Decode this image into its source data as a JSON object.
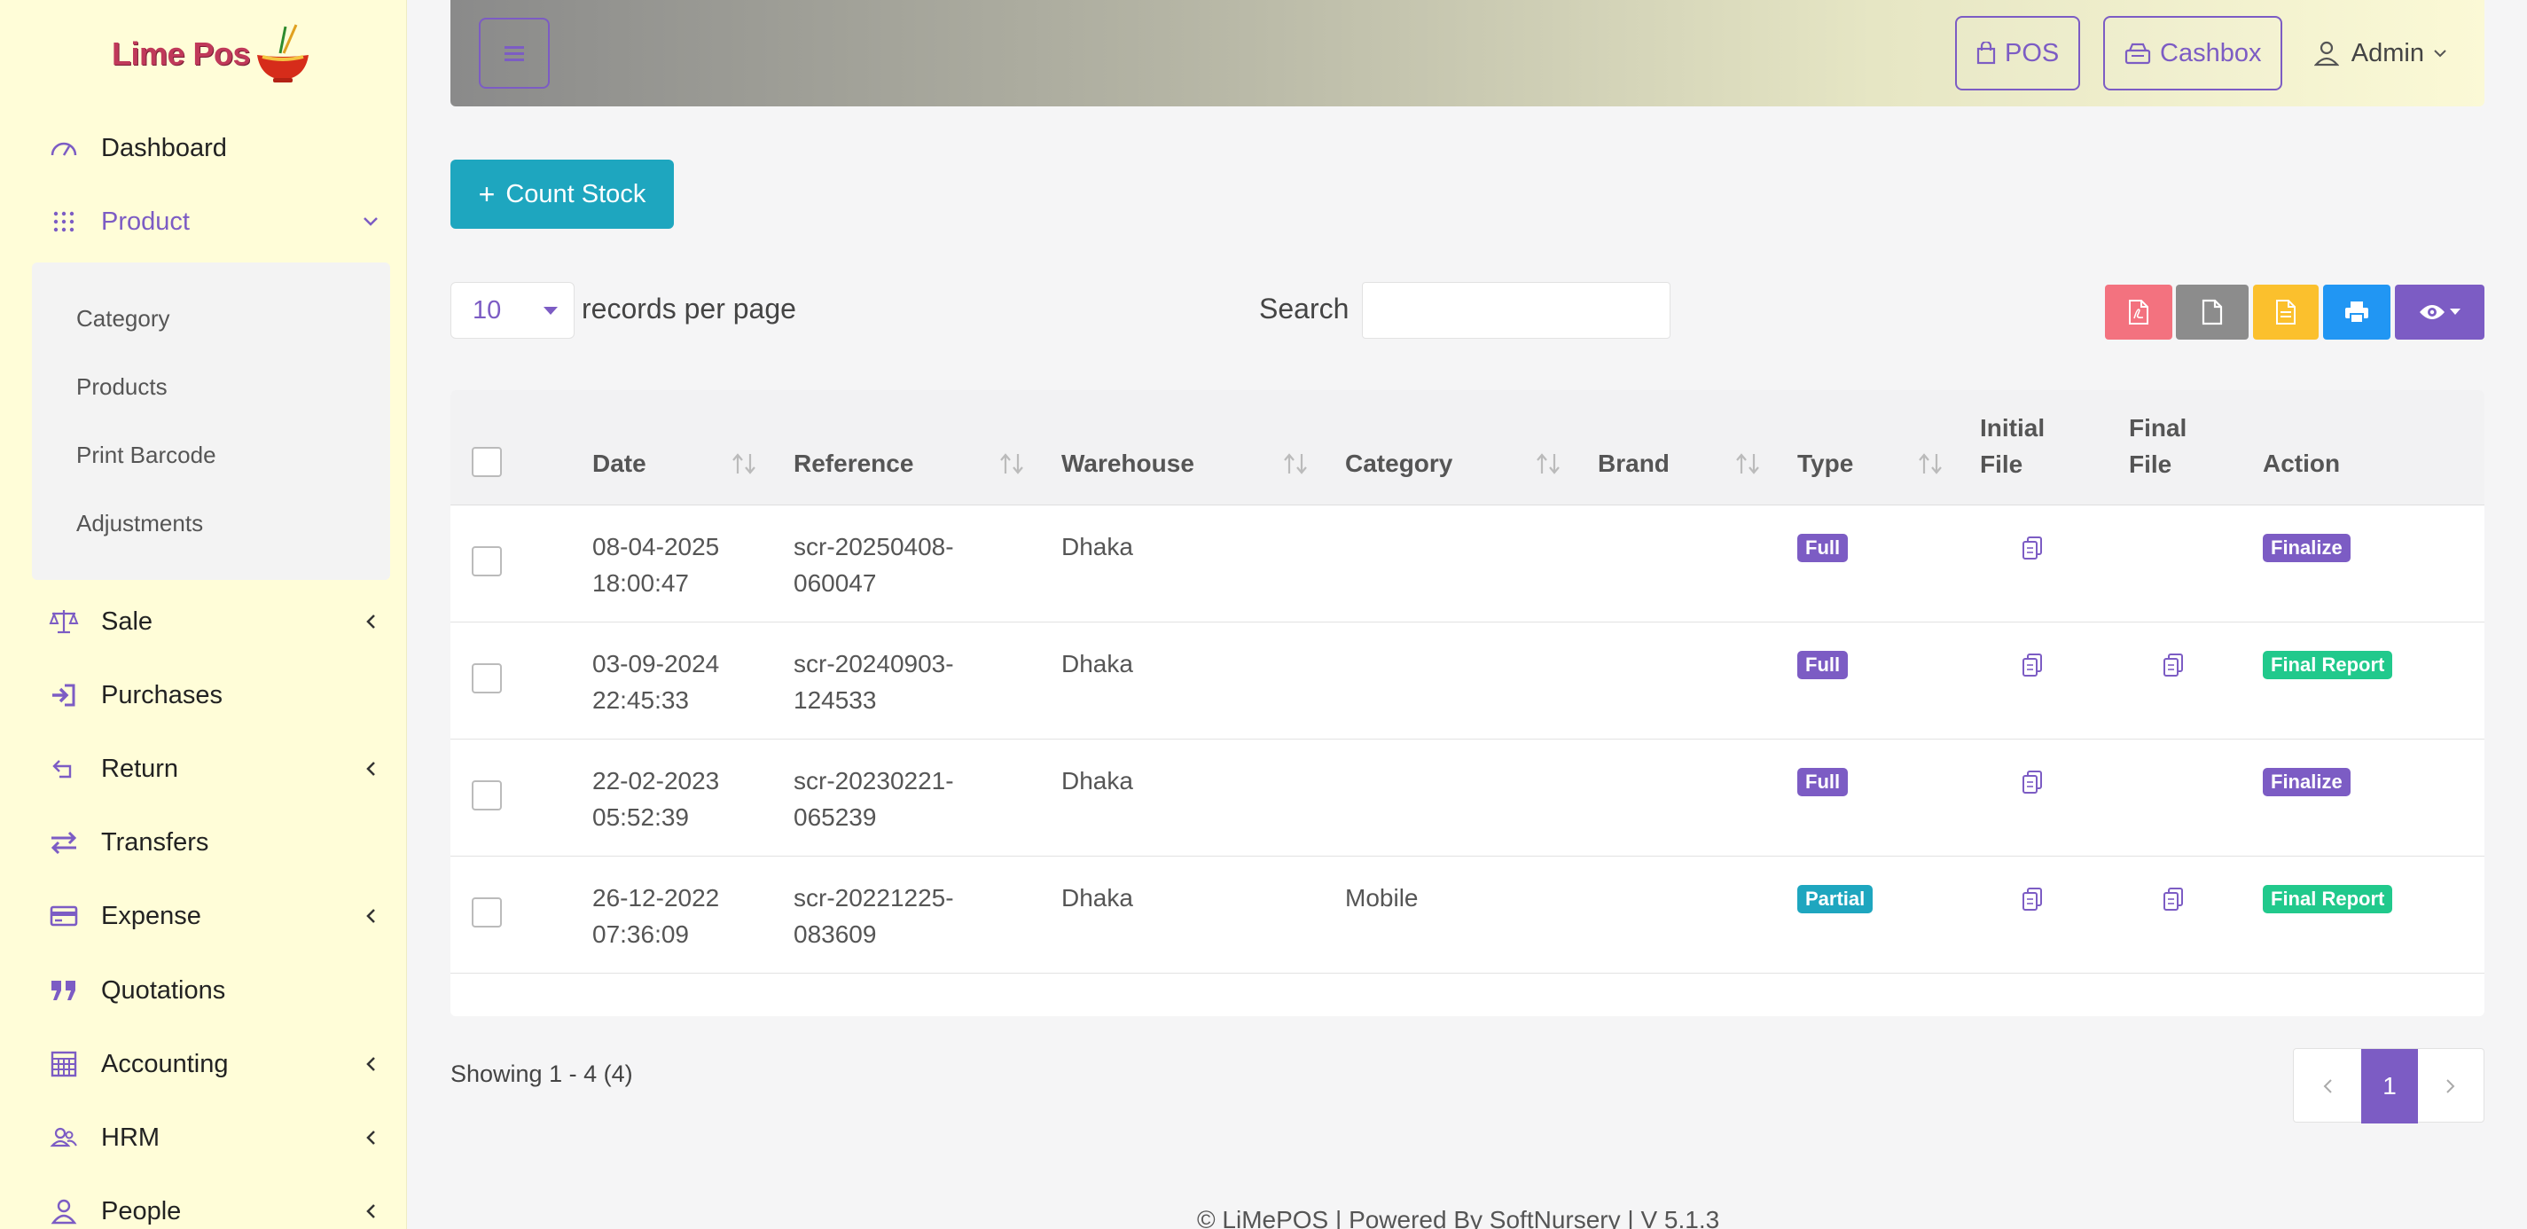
{
  "brand": {
    "name": "Lime Pos"
  },
  "sidebar": {
    "items": [
      {
        "label": "Dashboard",
        "icon": "gauge-icon"
      },
      {
        "label": "Product",
        "icon": "grid-dots-icon"
      },
      {
        "label": "Sale",
        "icon": "scale-icon"
      },
      {
        "label": "Purchases",
        "icon": "sign-in-icon"
      },
      {
        "label": "Return",
        "icon": "return-icon"
      },
      {
        "label": "Transfers",
        "icon": "transfer-icon"
      },
      {
        "label": "Expense",
        "icon": "card-icon"
      },
      {
        "label": "Quotations",
        "icon": "quote-icon"
      },
      {
        "label": "Accounting",
        "icon": "calculator-icon"
      },
      {
        "label": "HRM",
        "icon": "users-icon"
      },
      {
        "label": "People",
        "icon": "user-icon"
      }
    ],
    "product_submenu": [
      "Category",
      "Products",
      "Print Barcode",
      "Adjustments"
    ]
  },
  "header": {
    "pos_label": "POS",
    "cashbox_label": "Cashbox",
    "user_label": "Admin"
  },
  "toolbar": {
    "count_stock_label": "Count Stock",
    "per_page_value": "10",
    "per_page_label": "records per page",
    "search_label": "Search",
    "search_value": ""
  },
  "table": {
    "headers": {
      "date": "Date",
      "reference": "Reference",
      "warehouse": "Warehouse",
      "category": "Category",
      "brand": "Brand",
      "type": "Type",
      "initial_file_1": "Initial",
      "initial_file_2": "File",
      "final_file_1": "Final",
      "final_file_2": "File",
      "action": "Action"
    },
    "rows": [
      {
        "date1": "08-04-2025",
        "date2": "18:00:47",
        "ref1": "scr-20250408-",
        "ref2": "060047",
        "warehouse": "Dhaka",
        "category": "",
        "brand": "",
        "type": "Full",
        "action": "Finalize"
      },
      {
        "date1": "03-09-2024",
        "date2": "22:45:33",
        "ref1": "scr-20240903-",
        "ref2": "124533",
        "warehouse": "Dhaka",
        "category": "",
        "brand": "",
        "type": "Full",
        "action": "Final Report"
      },
      {
        "date1": "22-02-2023",
        "date2": "05:52:39",
        "ref1": "scr-20230221-",
        "ref2": "065239",
        "warehouse": "Dhaka",
        "category": "",
        "brand": "",
        "type": "Full",
        "action": "Finalize"
      },
      {
        "date1": "26-12-2022",
        "date2": "07:36:09",
        "ref1": "scr-20221225-",
        "ref2": "083609",
        "warehouse": "Dhaka",
        "category": "Mobile",
        "brand": "",
        "type": "Partial",
        "action": "Final Report"
      }
    ]
  },
  "pagination": {
    "showing": "Showing 1 - 4 (4)",
    "current_page": "1"
  },
  "footer": {
    "text": "© LiMePOS | Powered By SoftNursery | V 5.1.3"
  },
  "colors": {
    "accent": "#7c5cc4",
    "teal": "#1ea6bf",
    "green": "#21c98c",
    "pdf": "#f3727f",
    "csv": "#8c8c8c",
    "excel": "#fbc02d",
    "print": "#2196f3"
  }
}
